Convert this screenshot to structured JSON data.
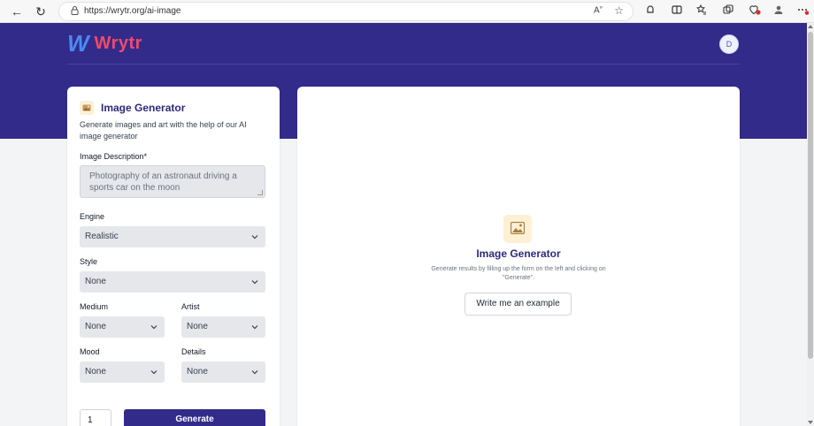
{
  "browser": {
    "url": "https://wrytr.org/ai-image",
    "back_icon": "←",
    "reload_icon": "↻",
    "lock_icon": "🔒",
    "read_aloud_icon": "A",
    "favorite_icon": "☆",
    "toolbar_icons": [
      "⟳",
      "▭",
      "✩",
      "⧉",
      "♡",
      "●",
      "⋯"
    ]
  },
  "brand": {
    "mark": "W",
    "name": "Wrytr",
    "avatar_initial": "D"
  },
  "form": {
    "title": "Image Generator",
    "description": "Generate images and art with the help of our AI image generator",
    "image_description_label": "Image Description*",
    "image_description_placeholder": "Photography of an astronaut driving a sports car on the moon",
    "engine_label": "Engine",
    "engine_value": "Realistic",
    "style_label": "Style",
    "style_value": "None",
    "medium_label": "Medium",
    "medium_value": "None",
    "artist_label": "Artist",
    "artist_value": "None",
    "mood_label": "Mood",
    "mood_value": "None",
    "details_label": "Details",
    "details_value": "None",
    "quantity_value": "1",
    "generate_label": "Generate"
  },
  "results": {
    "title": "Image Generator",
    "description": "Generate results by filling up the form on the left and clicking on \"Generate\".",
    "example_button_label": "Write me an example"
  },
  "colors": {
    "brand_primary": "#332b8a",
    "logo_mark": "#4a8af4",
    "logo_text": "#ef4b6b",
    "icon_bg": "#fdf0d5"
  }
}
